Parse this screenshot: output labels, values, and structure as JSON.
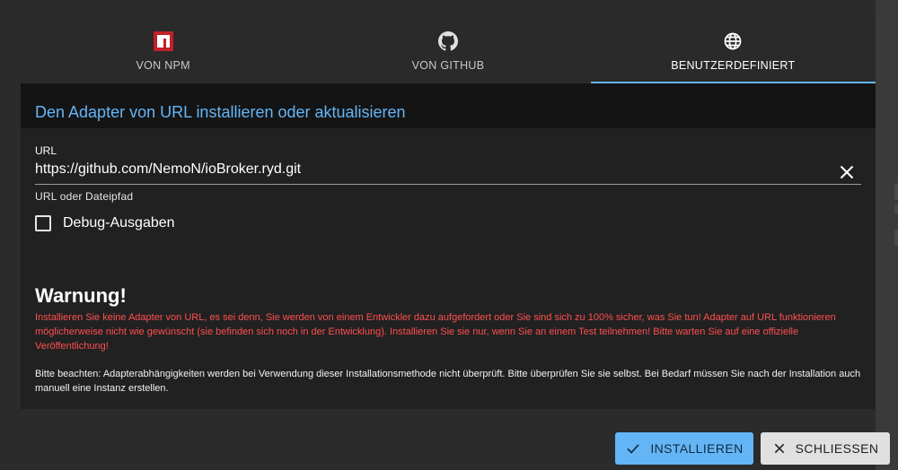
{
  "tabs": [
    {
      "label": "VON NPM",
      "icon": "npm-icon",
      "active": false
    },
    {
      "label": "VON GITHUB",
      "icon": "github-icon",
      "active": false
    },
    {
      "label": "BENUTZERDEFINIERT",
      "icon": "globe-icon",
      "active": true
    }
  ],
  "header": {
    "title": "Den Adapter von URL installieren oder aktualisieren"
  },
  "url_field": {
    "label": "URL",
    "value": "https://github.com/NemoN/ioBroker.ryd.git",
    "helper": "URL oder Dateipfad"
  },
  "debug": {
    "label": "Debug-Ausgaben",
    "checked": false
  },
  "warning": {
    "title": "Warnung!",
    "text": "Installieren Sie keine Adapter von URL, es sei denn, Sie werden von einem Entwickler dazu aufgefordert oder Sie sind sich zu 100% sicher, was Sie tun! Adapter auf URL funktionieren möglicherweise nicht wie gewünscht (sie befinden sich noch in der Entwicklung). Installieren Sie sie nur, wenn Sie an einem Test teilnehmen! Bitte warten Sie auf eine offizielle Veröffentlichung!"
  },
  "note": {
    "text": "Bitte beachten: Adapterabhängigkeiten werden bei Verwendung dieser Installationsmethode nicht überprüft. Bitte überprüfen Sie sie selbst. Bei Bedarf müssen Sie nach der Installation auch manuell eine Instanz erstellen."
  },
  "buttons": {
    "install": "INSTALLIEREN",
    "close": "SCHLIESSEN"
  },
  "colors": {
    "accent": "#64b5f6",
    "warning": "#ff4f4f",
    "npm": "#c12127"
  }
}
